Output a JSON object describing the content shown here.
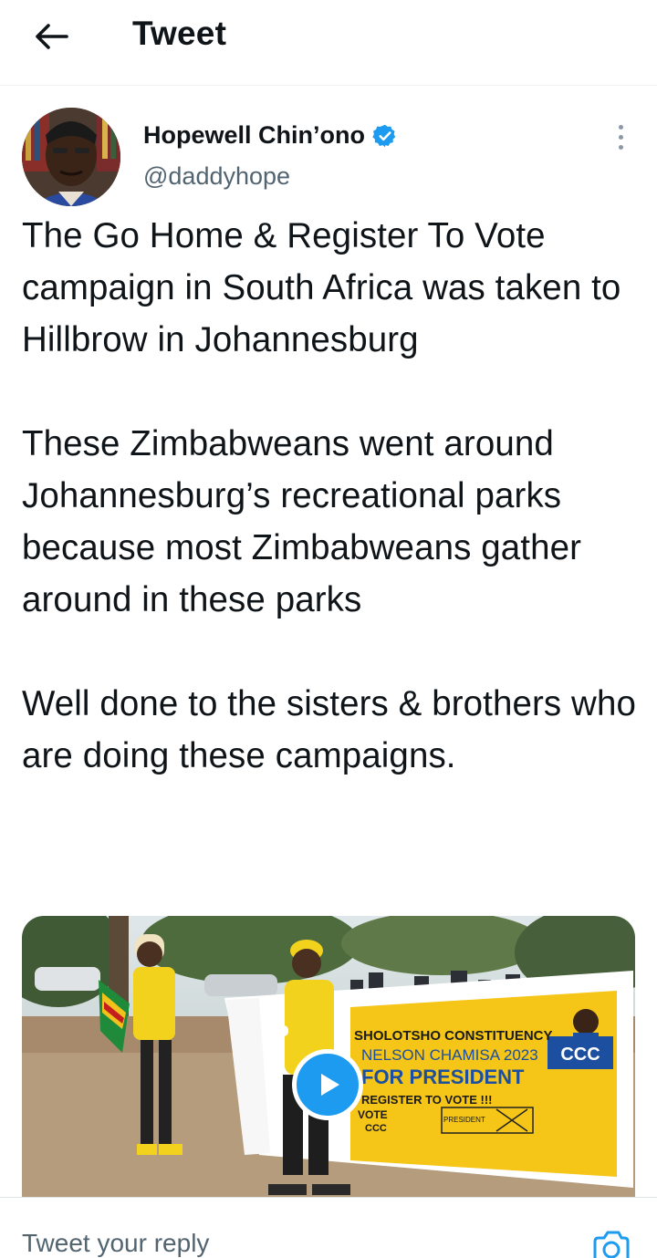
{
  "header": {
    "title": "Tweet",
    "back_icon": "arrow-left-icon"
  },
  "tweet": {
    "author_name": "Hopewell Chin’ono",
    "verified_icon": "verified-badge-icon",
    "handle": "@daddyhope",
    "more_icon": "more-vertical-icon",
    "text": "The Go Home & Register To Vote campaign in South Africa was taken to Hillbrow in Johannesburg\n\nThese Zimbabweans went around Johannesburg’s recreational parks because most Zimbabweans gather around in these parks\n\nWell done to the sisters & brothers who are doing these campaigns."
  },
  "media": {
    "type": "video",
    "play_icon": "play-icon",
    "banner": {
      "line1": "SHOLOTSHO CONSTITUENCY",
      "line2": "NELSON CHAMISA 2023",
      "line3": "FOR PRESIDENT",
      "line4": "REGISTER TO VOTE !!!",
      "vote": "VOTE",
      "ccc": "CCC",
      "president": "PRESIDENT",
      "party_logo_text": "CCC"
    }
  },
  "reply": {
    "placeholder": "Tweet your reply",
    "camera_icon": "camera-icon"
  },
  "colors": {
    "accent": "#1d9bf0",
    "text": "#0f1419",
    "secondary_text": "#536471",
    "banner_yellow": "#f5c518"
  }
}
